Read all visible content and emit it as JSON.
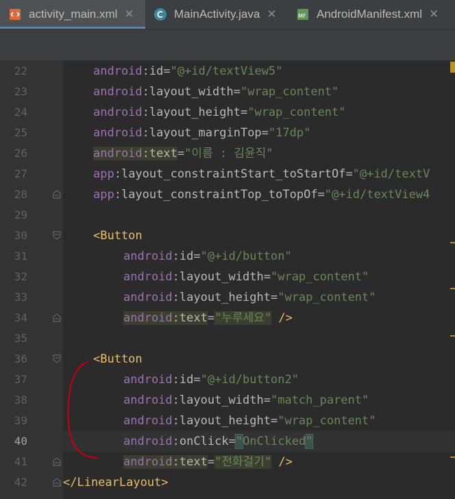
{
  "tabs": [
    {
      "label": "activity_main.xml",
      "icon": "xml-file-icon",
      "active": true
    },
    {
      "label": "MainActivity.java",
      "icon": "java-class-icon",
      "active": false
    },
    {
      "label": "AndroidManifest.xml",
      "icon": "manifest-file-icon",
      "active": false
    }
  ],
  "close_glyph": "✕",
  "manifest_badge": "MF",
  "line_numbers": [
    "22",
    "23",
    "24",
    "25",
    "26",
    "27",
    "28",
    "29",
    "30",
    "31",
    "32",
    "33",
    "34",
    "35",
    "36",
    "37",
    "38",
    "39",
    "40",
    "41",
    "42"
  ],
  "current_line": "40",
  "code": {
    "l22": {
      "ns": "android",
      "attr": "id",
      "eq": "=",
      "val": "\"@+id/textView5\""
    },
    "l23": {
      "ns": "android",
      "attr": "layout_width",
      "eq": "=",
      "val": "\"wrap_content\""
    },
    "l24": {
      "ns": "android",
      "attr": "layout_height",
      "eq": "=",
      "val": "\"wrap_content\""
    },
    "l25": {
      "ns": "android",
      "attr": "layout_marginTop",
      "eq": "=",
      "val": "\"17dp\""
    },
    "l26": {
      "ns": "android",
      "attr": "text",
      "eq": "=",
      "val": "\"이름 : 김윤직\""
    },
    "l27": {
      "ns": "app",
      "attr": "layout_constraintStart_toStartOf",
      "eq": "=",
      "val": "\"@+id/textV"
    },
    "l28": {
      "ns": "app",
      "attr": "layout_constraintTop_toTopOf",
      "eq": "=",
      "val": "\"@+id/textView4"
    },
    "l30": {
      "tag": "<Button"
    },
    "l31": {
      "ns": "android",
      "attr": "id",
      "eq": "=",
      "val": "\"@+id/button\""
    },
    "l32": {
      "ns": "android",
      "attr": "layout_width",
      "eq": "=",
      "val": "\"wrap_content\""
    },
    "l33": {
      "ns": "android",
      "attr": "layout_height",
      "eq": "=",
      "val": "\"wrap_content\""
    },
    "l34": {
      "ns": "android",
      "attr": "text",
      "eq": "=",
      "val": "\"누루세요\"",
      "close": " />"
    },
    "l36": {
      "tag": "<Button"
    },
    "l37": {
      "ns": "android",
      "attr": "id",
      "eq": "=",
      "val": "\"@+id/button2\""
    },
    "l38": {
      "ns": "android",
      "attr": "layout_width",
      "eq": "=",
      "val": "\"match_parent\""
    },
    "l39": {
      "ns": "android",
      "attr": "layout_height",
      "eq": "=",
      "val": "\"wrap_content\""
    },
    "l40": {
      "ns": "android",
      "attr": "onClick",
      "eq": "=",
      "q1": "\"",
      "v": "OnClicked",
      "q2": "\""
    },
    "l41": {
      "ns": "android",
      "attr": "text",
      "eq": "=",
      "val": "\"전화걸기\"",
      "close": " />"
    },
    "l42": {
      "tag": "</LinearLayout>"
    }
  },
  "colors": {
    "background": "#2b2b2b",
    "gutter": "#313335",
    "tab_bar": "#3c3f41",
    "namespace": "#9876aa",
    "attribute": "#bababa",
    "string_value": "#6a8759",
    "tag": "#e8bf6a",
    "annotation_stroke": "#c8000a",
    "scroll_marker": "#be9117",
    "active_tab_underline": "#4a88c7"
  }
}
